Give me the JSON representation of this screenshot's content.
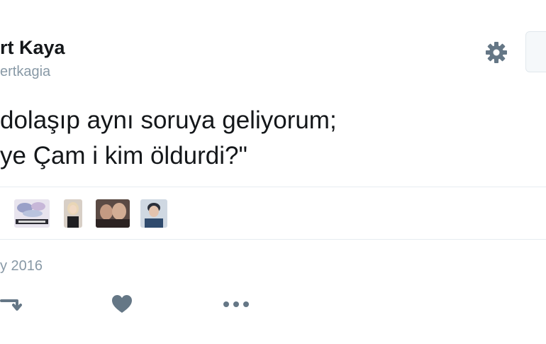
{
  "tweet": {
    "display_name": "rt Kaya",
    "handle": "ertkagia",
    "text_line_1": "dolaşıp aynı soruya geliyorum;",
    "text_line_2": "ye Çam i kim öldurdi?\"",
    "timestamp": "y 2016"
  },
  "header": {
    "settings_icon": "gear-icon"
  },
  "actions": {
    "retweet_icon": "retweet-icon",
    "like_icon": "heart-icon",
    "more_icon": "more-dots-icon"
  },
  "colors": {
    "text": "#14171a",
    "secondary": "#8899a6",
    "icon": "#657786",
    "divider": "#e6ecf0"
  }
}
